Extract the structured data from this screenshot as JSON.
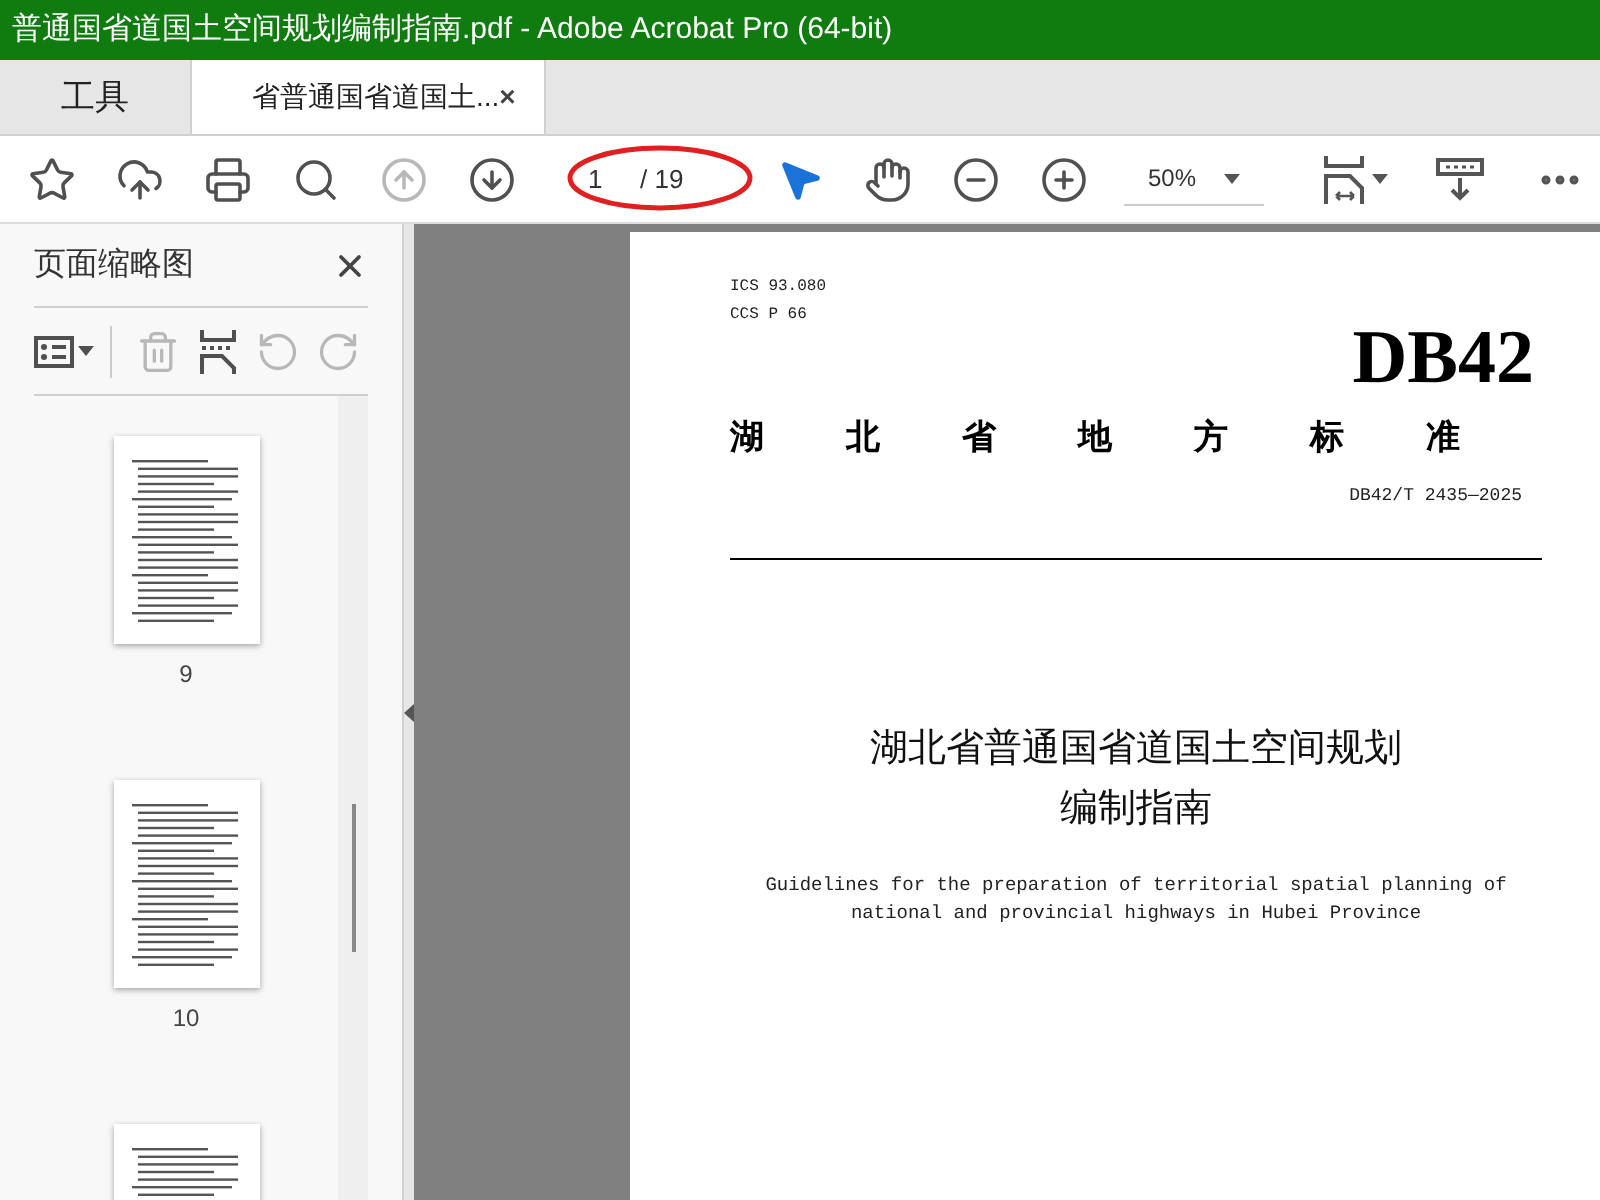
{
  "window": {
    "title": "普通国省道国土空间规划编制指南.pdf - Adobe Acrobat Pro (64-bit)"
  },
  "tabs": [
    {
      "label": "工具",
      "selected": false
    },
    {
      "label": "省普通国省道国土...",
      "selected": true,
      "close": "×"
    }
  ],
  "toolbar": {
    "tools": [
      {
        "kind": "bookmark",
        "disabled": false
      },
      {
        "kind": "upload",
        "disabled": false
      },
      {
        "kind": "print",
        "disabled": false
      },
      {
        "kind": "search",
        "disabled": false
      },
      {
        "kind": "prev",
        "disabled": true
      },
      {
        "kind": "next",
        "disabled": false
      }
    ],
    "page_number": "1",
    "page_total": "/ 19",
    "tools_after": [
      {
        "kind": "select",
        "selected": true
      },
      {
        "kind": "hand",
        "selected": false
      },
      {
        "kind": "zoom-out",
        "selected": false
      },
      {
        "kind": "zoom-in",
        "selected": false
      }
    ],
    "zoom": "50%"
  },
  "sidebar": {
    "title": "页面缩略图",
    "tools": [
      {
        "kind": "options",
        "disabled": false
      },
      {
        "kind": "delete",
        "disabled": true
      },
      {
        "kind": "insert",
        "disabled": false
      },
      {
        "kind": "undo",
        "disabled": true
      },
      {
        "kind": "redo",
        "disabled": true
      }
    ],
    "thumbnails": [
      {
        "label": "9",
        "selected": false
      },
      {
        "label": "10",
        "selected": false
      },
      {
        "selected": false
      }
    ]
  },
  "document": {
    "ics": "ICS  93.080",
    "ccs": "CCS  P 66",
    "code": "DB42",
    "standard": "湖北省地方标准",
    "number": "DB42/T 2435—2025",
    "title_lines": [
      "湖北省普通国省道国土空间规划",
      "编制指南"
    ],
    "english_lines": [
      "Guidelines for the preparation of territorial spatial planning of",
      "national and provincial highways in Hubei Province"
    ]
  }
}
